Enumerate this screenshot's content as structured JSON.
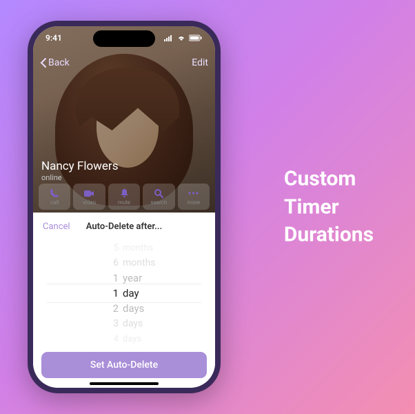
{
  "status": {
    "time": "9:41"
  },
  "nav": {
    "back": "Back",
    "edit": "Edit"
  },
  "contact": {
    "name": "Nancy Flowers",
    "status": "online"
  },
  "actions": {
    "call": "call",
    "video": "video",
    "mute": "mute",
    "search": "search",
    "more": "more"
  },
  "sheet": {
    "cancel": "Cancel",
    "title": "Auto-Delete after...",
    "confirm": "Set Auto-Delete"
  },
  "picker": {
    "r0": {
      "n": "5",
      "u": "months"
    },
    "r1": {
      "n": "6",
      "u": "months"
    },
    "r2": {
      "n": "1",
      "u": "year"
    },
    "r3": {
      "n": "1",
      "u": "day"
    },
    "r4": {
      "n": "2",
      "u": "days"
    },
    "r5": {
      "n": "3",
      "u": "days"
    },
    "r6": {
      "n": "4",
      "u": "days"
    }
  },
  "headline": {
    "l1": "Custom",
    "l2": "Timer",
    "l3": "Durations"
  }
}
